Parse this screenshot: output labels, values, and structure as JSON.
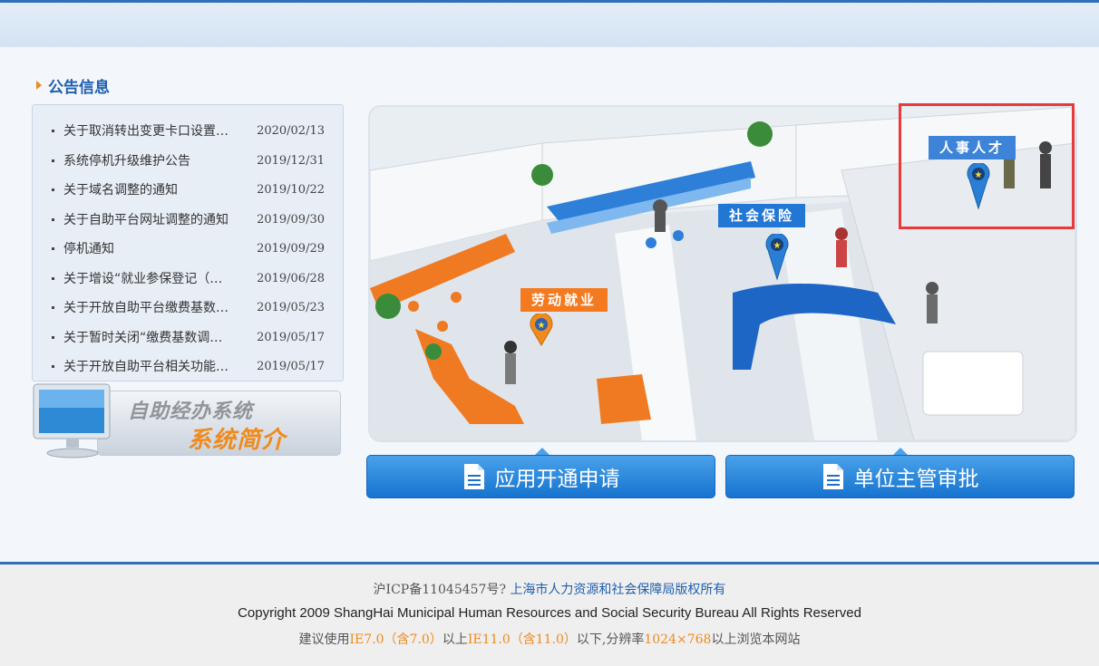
{
  "notices": {
    "title": "公告信息",
    "items": [
      {
        "title": "关于取消转出变更卡口设置…",
        "date": "2020/02/13"
      },
      {
        "title": "系统停机升级维护公告",
        "date": "2019/12/31"
      },
      {
        "title": "关于域名调整的通知",
        "date": "2019/10/22"
      },
      {
        "title": "关于自助平台网址调整的通知",
        "date": "2019/09/30"
      },
      {
        "title": "停机通知",
        "date": "2019/09/29"
      },
      {
        "title": "关于增设“就业参保登记（…",
        "date": "2019/06/28"
      },
      {
        "title": "关于开放自助平台缴费基数…",
        "date": "2019/05/23"
      },
      {
        "title": "关于暂时关闭“缴费基数调…",
        "date": "2019/05/17"
      },
      {
        "title": "关于开放自助平台相关功能…",
        "date": "2019/05/17"
      }
    ]
  },
  "intro_banner": {
    "line1": "自助经办系统",
    "line2": "系统简介"
  },
  "hall": {
    "zones": {
      "labor": "劳动就业",
      "social": "社会保险",
      "personnel": "人事人才"
    }
  },
  "buttons": {
    "apply": "应用开通申请",
    "approve": "单位主管审批"
  },
  "footer": {
    "icp": "沪ICP备11045457号?",
    "copyright_link": "上海市人力资源和社会保障局版权所有",
    "copyright_en": "Copyright 2009 ShangHai Municipal Human Resources and Social Security Bureau All Rights Reserved",
    "browser_pre": "建议使用",
    "ie_min": "IE7.0（含7.0）",
    "browser_mid": "以上",
    "ie_max": "IE11.0（含11.0）",
    "browser_mid2": "以下,分辨率",
    "resolution": "1024×768",
    "browser_post": "以上浏览本网站"
  },
  "colors": {
    "accent_blue": "#1f5fae",
    "accent_orange": "#f08a1c",
    "highlight_red": "#e83a3a"
  }
}
